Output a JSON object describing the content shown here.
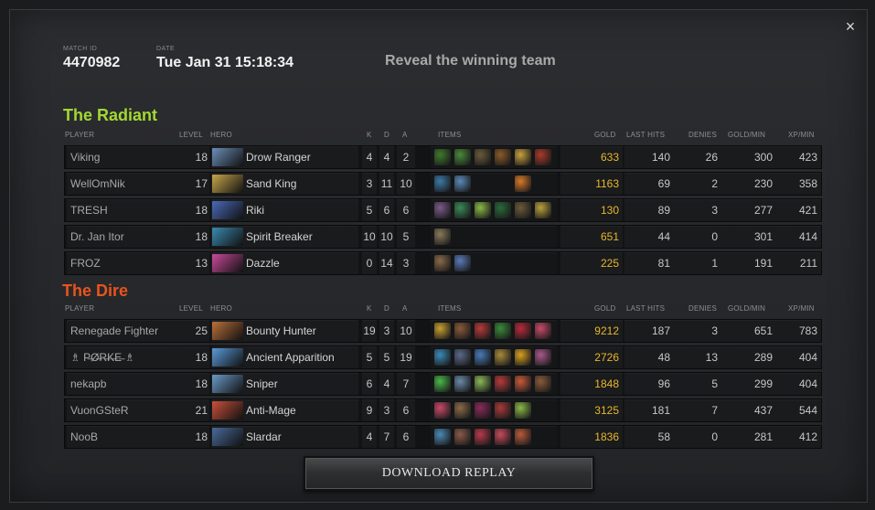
{
  "close_symbol": "×",
  "match": {
    "id_label": "MATCH ID",
    "id_value": "4470982",
    "date_label": "DATE",
    "date_value": "Tue Jan 31 15:18:34"
  },
  "reveal_text": "Reveal the winning team",
  "columns": {
    "player": "PLAYER",
    "level": "LEVEL",
    "hero": "HERO",
    "k": "K",
    "d": "D",
    "a": "A",
    "items": "ITEMS",
    "gold": "GOLD",
    "last_hits": "LAST HITS",
    "denies": "DENIES",
    "gold_min": "GOLD/MIN",
    "xp_min": "XP/MIN"
  },
  "teams": [
    {
      "name": "The Radiant",
      "color": "#a3d832",
      "players": [
        {
          "player": "Viking",
          "level": "18",
          "hero": "Drow Ranger",
          "hero_color": "#6b8fb8",
          "k": "4",
          "d": "4",
          "a": "2",
          "items": [
            "#3f7a2c",
            "#4a8a3a",
            "#6b5a3a",
            "#8a5a2a",
            "#c8a040",
            "#a83a2a"
          ],
          "gold": "633",
          "last_hits": "140",
          "denies": "26",
          "gold_min": "300",
          "xp_min": "423"
        },
        {
          "player": "WellOmNik",
          "level": "17",
          "hero": "Sand King",
          "hero_color": "#c7a64a",
          "k": "3",
          "d": "11",
          "a": "10",
          "items": [
            "#3a7aa8",
            "#5a8ab8",
            "",
            "",
            "#d87a2a",
            ""
          ],
          "gold": "1163",
          "last_hits": "69",
          "denies": "2",
          "gold_min": "230",
          "xp_min": "358"
        },
        {
          "player": "TRESH",
          "level": "18",
          "hero": "Riki",
          "hero_color": "#4a6ab8",
          "k": "5",
          "d": "6",
          "a": "6",
          "items": [
            "#7a5a8a",
            "#3a8a5a",
            "#8ab848",
            "#2a6a3a",
            "#6a5a3a",
            "#b8a040"
          ],
          "gold": "130",
          "last_hits": "89",
          "denies": "3",
          "gold_min": "277",
          "xp_min": "421"
        },
        {
          "player": "Dr. Jan Itor",
          "level": "18",
          "hero": "Spirit Breaker",
          "hero_color": "#3a8ab0",
          "k": "10",
          "d": "10",
          "a": "5",
          "items": [
            "#8a7a5a",
            "",
            "",
            "",
            "",
            ""
          ],
          "gold": "651",
          "last_hits": "44",
          "denies": "0",
          "gold_min": "301",
          "xp_min": "414"
        },
        {
          "player": "FROZ",
          "level": "13",
          "hero": "Dazzle",
          "hero_color": "#c84a9a",
          "k": "0",
          "d": "14",
          "a": "3",
          "items": [
            "#8a6a4a",
            "#5a7ab8",
            "",
            "",
            "",
            ""
          ],
          "gold": "225",
          "last_hits": "81",
          "denies": "1",
          "gold_min": "191",
          "xp_min": "211"
        }
      ]
    },
    {
      "name": "The Dire",
      "color": "#e8541d",
      "players": [
        {
          "player": "Renegade Fighter",
          "level": "25",
          "hero": "Bounty Hunter",
          "hero_color": "#b8703a",
          "k": "19",
          "d": "3",
          "a": "10",
          "items": [
            "#c8a030",
            "#8a5a3a",
            "#b83a3a",
            "#3a8a3a",
            "#b82a3a",
            "#c84a6a"
          ],
          "gold": "9212",
          "last_hits": "187",
          "denies": "3",
          "gold_min": "651",
          "xp_min": "783"
        },
        {
          "player": "♗ P̶Ø̶R̶K̶E̶ ♗",
          "level": "18",
          "hero": "Ancient Apparition",
          "hero_color": "#5a9ad8",
          "k": "5",
          "d": "5",
          "a": "19",
          "items": [
            "#3a8ab8",
            "#5a6a8a",
            "#4a7ab8",
            "#a88a3a",
            "#d8a020",
            "#a85a8a"
          ],
          "gold": "2726",
          "last_hits": "48",
          "denies": "13",
          "gold_min": "289",
          "xp_min": "404"
        },
        {
          "player": "nekapb",
          "level": "18",
          "hero": "Sniper",
          "hero_color": "#6a9ac8",
          "k": "6",
          "d": "4",
          "a": "7",
          "items": [
            "#4ab84a",
            "#6a8aa8",
            "#8ab858",
            "#b83a3a",
            "#c85a3a",
            "#8a5a3a"
          ],
          "gold": "1848",
          "last_hits": "96",
          "denies": "5",
          "gold_min": "299",
          "xp_min": "404"
        },
        {
          "player": "VuonGSteR",
          "level": "21",
          "hero": "Anti-Mage",
          "hero_color": "#c8503a",
          "k": "9",
          "d": "3",
          "a": "6",
          "items": [
            "#c84a6a",
            "#8a6a4a",
            "#8a2a5a",
            "#a83a3a",
            "#8ab848",
            ""
          ],
          "gold": "3125",
          "last_hits": "181",
          "denies": "7",
          "gold_min": "437",
          "xp_min": "544"
        },
        {
          "player": "NooB",
          "level": "18",
          "hero": "Slardar",
          "hero_color": "#4a6a9a",
          "k": "4",
          "d": "7",
          "a": "6",
          "items": [
            "#4a8ab8",
            "#8a5a4a",
            "#b83a4a",
            "#c84a5a",
            "#b85a3a",
            ""
          ],
          "gold": "1836",
          "last_hits": "58",
          "denies": "0",
          "gold_min": "281",
          "xp_min": "412"
        }
      ]
    }
  ],
  "download_label": "DOWNLOAD REPLAY"
}
